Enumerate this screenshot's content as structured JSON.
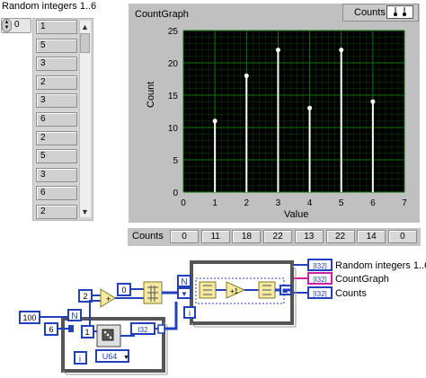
{
  "array": {
    "title": "Random integers 1..6",
    "index": "0",
    "values": [
      "1",
      "5",
      "3",
      "2",
      "3",
      "6",
      "2",
      "5",
      "3",
      "6",
      "2"
    ]
  },
  "graph": {
    "title": "CountGraph",
    "legend_label": "Counts",
    "xlabel": "Value",
    "ylabel": "Count",
    "plot_bg": "#000000",
    "grid_color": "#0f7a0f",
    "panel_color": "#c0c0c0"
  },
  "chart_data": {
    "type": "scatter",
    "title": "CountGraph",
    "xlabel": "Value",
    "ylabel": "Count",
    "x": [
      1,
      2,
      3,
      4,
      5,
      6
    ],
    "values": [
      11,
      18,
      22,
      13,
      22,
      14
    ],
    "xlim": [
      0,
      7
    ],
    "ylim": [
      0,
      25
    ],
    "xticks": [
      0,
      1,
      2,
      3,
      4,
      5,
      6,
      7
    ],
    "yticks": [
      0,
      5,
      10,
      15,
      20,
      25
    ],
    "grid": true,
    "series": [
      {
        "name": "Counts",
        "color": "#ffffff"
      }
    ]
  },
  "counts": {
    "label": "Counts",
    "values": [
      "0",
      "11",
      "18",
      "22",
      "13",
      "22",
      "14",
      "0"
    ]
  },
  "block_diagram": {
    "const_100": "100",
    "const_6": "6",
    "const_2": "2",
    "const_0": "0",
    "const_1": "1",
    "loop_n": "N",
    "loop_i": "i",
    "type_i32": "I32",
    "type_u64": "U64",
    "ind_random": "Random integers 1..6",
    "ind_graph": "CountGraph",
    "ind_counts": "Counts",
    "wire_orange": "#f07820",
    "wire_blue": "#2040c0",
    "wire_pink": "#d020a0"
  }
}
